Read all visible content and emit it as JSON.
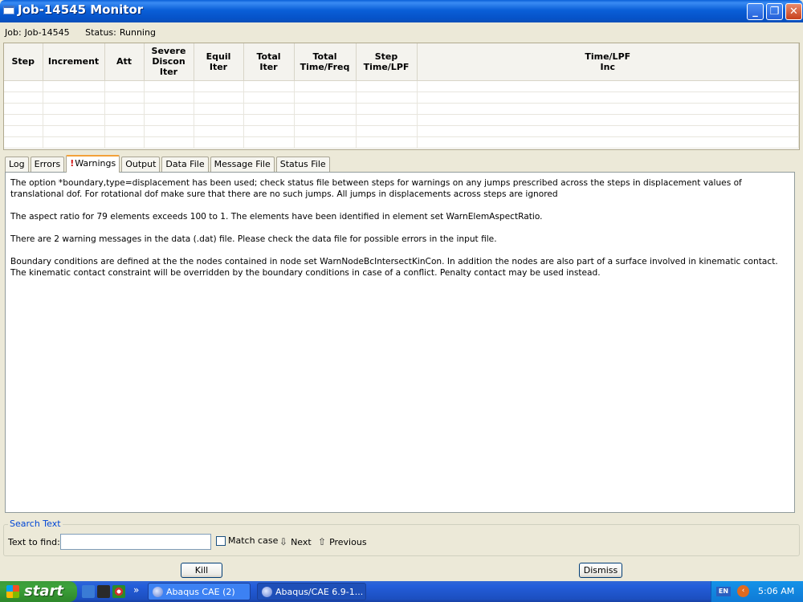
{
  "window": {
    "title": "Job-14545 Monitor"
  },
  "job": {
    "label": "Job:",
    "id": "Job-14545",
    "status_label": "Status:",
    "status": "Running"
  },
  "table": {
    "columns": [
      "Step",
      "Increment",
      "Att",
      "Severe\nDiscon\nIter",
      "Equil\nIter",
      "Total\nIter",
      "Total\nTime/Freq",
      "Step\nTime/LPF",
      "Time/LPF\nInc"
    ],
    "rows": []
  },
  "tabs": [
    {
      "label": "Log"
    },
    {
      "label": "Errors"
    },
    {
      "label": "Warnings",
      "icon": "warning-icon",
      "active": true
    },
    {
      "label": "Output"
    },
    {
      "label": "Data File"
    },
    {
      "label": "Message File"
    },
    {
      "label": "Status File"
    }
  ],
  "warnings": [
    "The option *boundary,type=displacement has been used; check status file between steps for warnings on any jumps prescribed across the steps in displacement values of translational dof. For rotational dof make sure that there are no such jumps. All jumps in displacements across steps are ignored",
    "The aspect ratio for 79 elements exceeds 100 to 1. The elements have been identified in element set WarnElemAspectRatio.",
    "There are 2 warning messages in the data (.dat) file.  Please check the data file for possible errors in the input file.",
    "Boundary conditions are defined at the the nodes contained in node set WarnNodeBcIntersectKinCon. In addition the nodes are also part of a surface involved in kinematic contact. The kinematic contact constraint will be overridden by the boundary conditions in case of a conflict. Penalty contact may be used instead."
  ],
  "search": {
    "legend": "Search Text",
    "find_label": "Text to find:",
    "find_value": "",
    "match_case_label": "Match case",
    "match_case_checked": false,
    "next_label": "Next",
    "previous_label": "Previous"
  },
  "buttons": {
    "kill": "Kill",
    "dismiss": "Dismiss"
  },
  "taskbar": {
    "start_label": "start",
    "items": [
      "Abaqus CAE (2)",
      "Abaqus/CAE 6.9-1..."
    ],
    "language": "EN",
    "clock": "5:06 AM"
  },
  "colors": {
    "titlebar": "#0a5fd8",
    "active_tab": "#f3a13a",
    "search_legend": "#0046d5",
    "start": "#3c9a3a"
  }
}
